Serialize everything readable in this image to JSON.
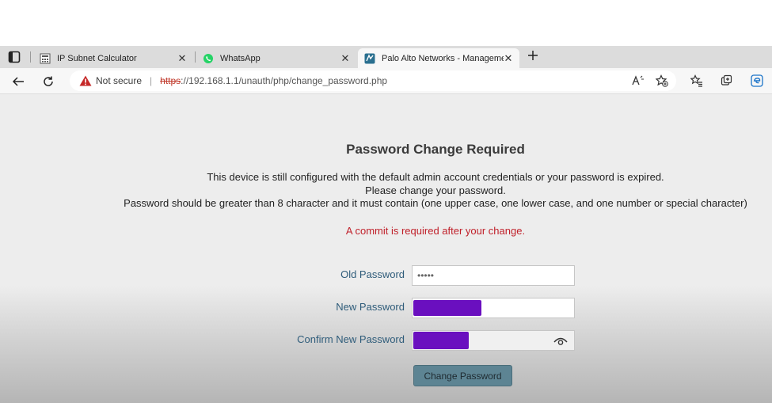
{
  "browser": {
    "tabs": [
      {
        "title": "IP Subnet Calculator",
        "active": false
      },
      {
        "title": "WhatsApp",
        "active": false
      },
      {
        "title": "Palo Alto Networks - Manageme",
        "active": true
      }
    ],
    "address": {
      "security_label": "Not secure",
      "scheme": "https",
      "url_rest": "://192.168.1.1/unauth/php/change_password.php"
    }
  },
  "page": {
    "heading": "Password Change Required",
    "message_line1": "This device is still configured with the default admin account credentials or your password is expired.",
    "message_line2": "Please change your password.",
    "message_line3": "Password should be greater than 8 character and it must contain (one upper case, one lower case, and one number or special character)",
    "commit_note": "A commit is required after your change.",
    "form": {
      "old_password_label": "Old Password",
      "old_password_value": "•••••",
      "new_password_label": "New Password",
      "confirm_password_label": "Confirm New Password",
      "submit_label": "Change Password"
    }
  },
  "colors": {
    "commit_note": "#c0202a",
    "label": "#2f5c7a",
    "button": "#5d8493",
    "redaction": "#6a0fbf"
  }
}
